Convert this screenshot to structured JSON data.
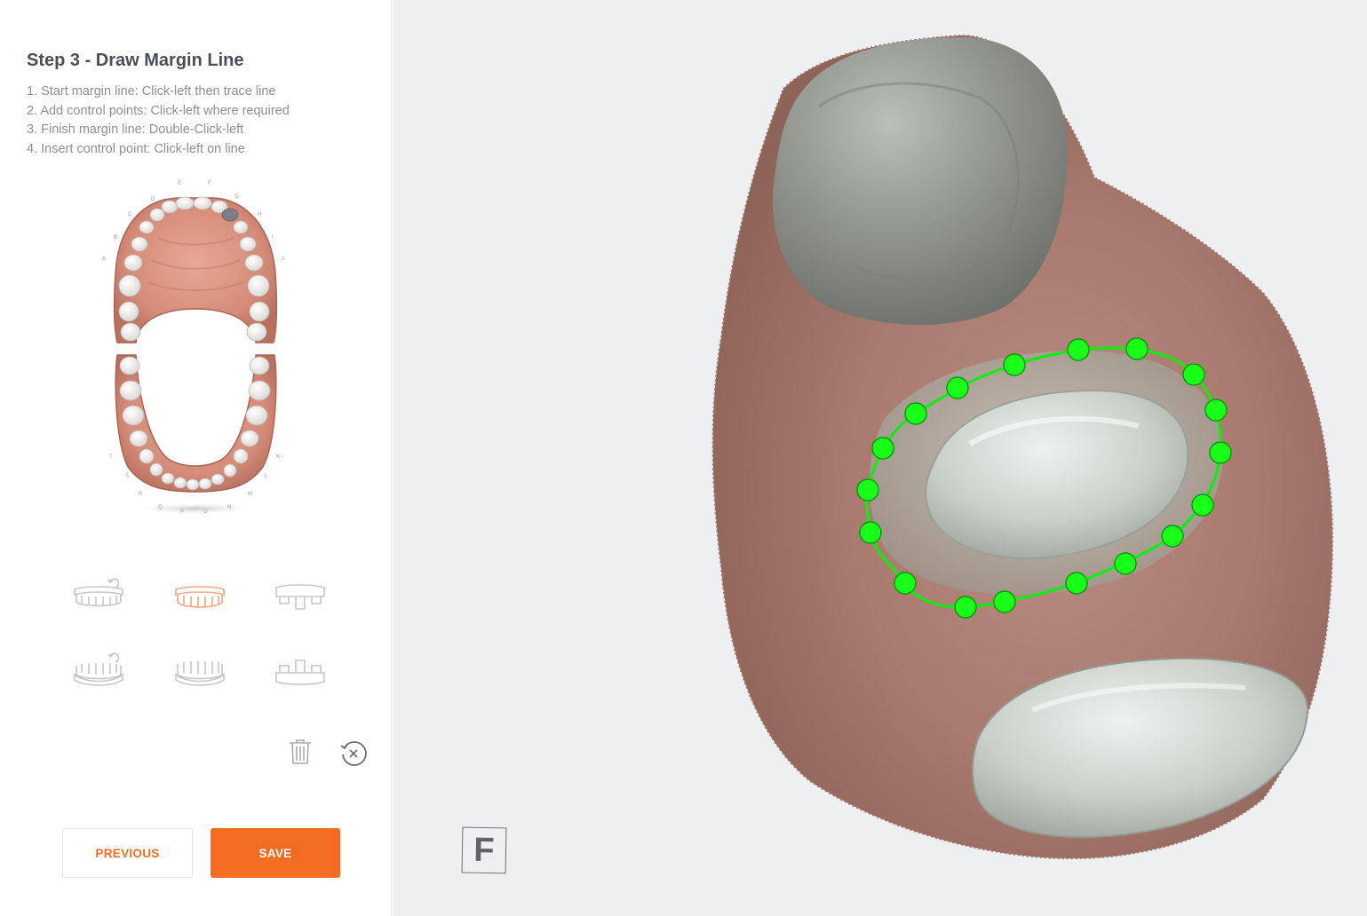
{
  "panel": {
    "title": "Step 3 - Draw Margin Line",
    "instructions": [
      "1. Start margin line: Click-left then trace line",
      "2. Add control points: Click-left where required",
      "3. Finish margin line: Double-Click-left",
      "4. Insert control point: Click-left on line"
    ],
    "tooth_chart": {
      "upper_letters": [
        "A",
        "B",
        "C",
        "D",
        "E",
        "F",
        "G",
        "H",
        "I",
        "J"
      ],
      "lower_letters": [
        "K",
        "L",
        "M",
        "N",
        "O",
        "P",
        "Q",
        "R",
        "S",
        "T"
      ]
    },
    "jaw_modes": [
      {
        "name": "upper-jaw-rotate",
        "active": false
      },
      {
        "name": "upper-jaw",
        "active": true
      },
      {
        "name": "upper-jaw-partial",
        "active": false
      },
      {
        "name": "lower-jaw-rotate",
        "active": false
      },
      {
        "name": "lower-jaw",
        "active": false
      },
      {
        "name": "lower-jaw-partial",
        "active": false
      }
    ],
    "tools": [
      "trash-icon",
      "reset-icon"
    ],
    "buttons": {
      "previous": "PREVIOUS",
      "save": "SAVE"
    }
  },
  "viewport": {
    "view_badge": "F",
    "margin_line_color": "#00ff00",
    "control_points_count": 22
  },
  "colors": {
    "accent": "#f26d21",
    "active_jaw": "#f7a47f",
    "inactive_jaw": "#c4c6c9",
    "viewport_bg": "#eeeff1"
  }
}
